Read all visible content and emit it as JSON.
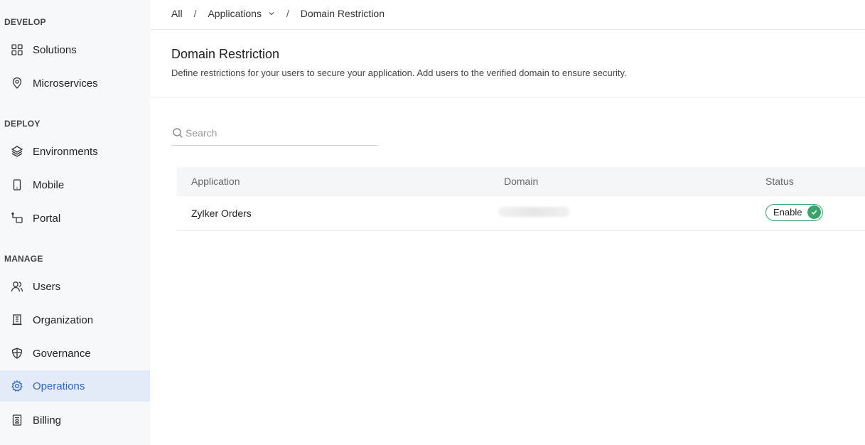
{
  "sidebar": {
    "sections": [
      {
        "label": "DEVELOP"
      },
      {
        "label": "DEPLOY"
      },
      {
        "label": "MANAGE"
      }
    ],
    "items": [
      {
        "label": "Solutions",
        "icon": "grid-icon"
      },
      {
        "label": "Microservices",
        "icon": "map-pin-icon"
      },
      {
        "label": "Environments",
        "icon": "layers-icon"
      },
      {
        "label": "Mobile",
        "icon": "phone-icon"
      },
      {
        "label": "Portal",
        "icon": "portal-icon"
      },
      {
        "label": "Users",
        "icon": "users-icon"
      },
      {
        "label": "Organization",
        "icon": "building-icon"
      },
      {
        "label": "Governance",
        "icon": "shield-icon"
      },
      {
        "label": "Operations",
        "icon": "gear-icon",
        "active": true
      },
      {
        "label": "Billing",
        "icon": "receipt-icon"
      }
    ]
  },
  "breadcrumb": {
    "all": "All",
    "applications": "Applications",
    "current": "Domain Restriction",
    "separator": "/"
  },
  "header": {
    "title": "Domain Restriction",
    "description": "Define restrictions for your users to secure your application. Add users to the verified domain to ensure security."
  },
  "search": {
    "placeholder": "Search",
    "value": ""
  },
  "table": {
    "columns": [
      "Application",
      "Domain",
      "Status"
    ],
    "rows": [
      {
        "application": "Zylker Orders",
        "domain": "",
        "status": "Enable",
        "enabled": true
      }
    ]
  },
  "colors": {
    "accent": "#2f66c8",
    "active_bg": "#e4ebf8",
    "success": "#3aa26a"
  }
}
